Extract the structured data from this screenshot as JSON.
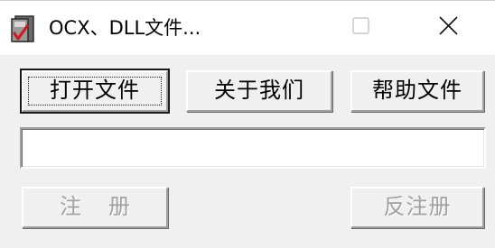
{
  "window": {
    "title": "OCX、DLL文件...",
    "icon": "app-register-icon",
    "controls": {
      "minimize": "minimize-icon",
      "maximize": "maximize-icon",
      "close": "close-icon"
    }
  },
  "buttons": {
    "open_file": "打开文件",
    "about_us": "关于我们",
    "help_file": "帮助文件",
    "register": "注册",
    "unregister": "反注册"
  },
  "path_input": {
    "value": "",
    "placeholder": ""
  },
  "colors": {
    "window_bg": "#f0f0f0",
    "titlebar_bg": "#ffffff",
    "disabled_text": "#a0a0a0"
  }
}
